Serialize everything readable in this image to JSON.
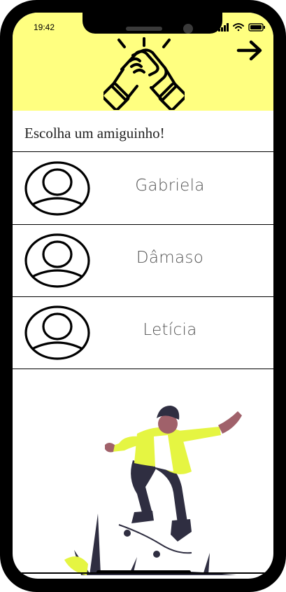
{
  "status_bar": {
    "time": "19:42"
  },
  "header": {
    "next_icon": "arrow-right-icon",
    "logo_icon": "handshake-icon",
    "background": "#ffff80"
  },
  "title": "Escolha um amiguinho!",
  "friends": [
    {
      "name": "Gabriela",
      "avatar_icon": "user-avatar-icon"
    },
    {
      "name": "Dâmaso",
      "avatar_icon": "user-avatar-icon"
    },
    {
      "name": "Letícia",
      "avatar_icon": "user-avatar-icon"
    }
  ],
  "illustration": {
    "icon": "skateboarder-illustration",
    "accent": "#e5f542"
  }
}
